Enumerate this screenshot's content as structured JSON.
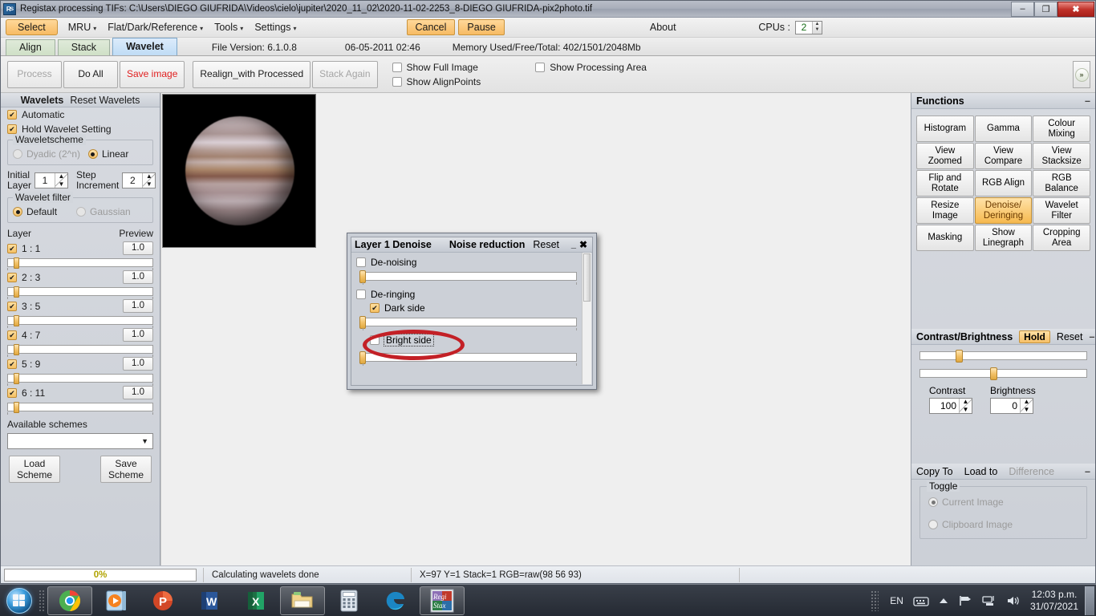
{
  "window": {
    "title": "Registax processing TIFs: C:\\Users\\DIEGO GIUFRIDA\\Videos\\cielo\\jupiter\\2020_11_02\\2020-11-02-2253_8-DIEGO GIUFRIDA-pix2photo.tif",
    "app_icon": "registax-icon",
    "minimize": "–",
    "maximize": "❐",
    "close": "✖"
  },
  "menubar": {
    "select": "Select",
    "items": [
      {
        "label": "MRU",
        "caret": "▾"
      },
      {
        "label": "Flat/Dark/Reference",
        "caret": "▾"
      },
      {
        "label": "Tools",
        "caret": "▾"
      },
      {
        "label": "Settings",
        "caret": "▾"
      }
    ],
    "cancel": "Cancel",
    "pause": "Pause",
    "about": "About",
    "cpus_label": "CPUs :",
    "cpus_value": "2"
  },
  "tabs": [
    {
      "label": "Align",
      "active": false
    },
    {
      "label": "Stack",
      "active": false
    },
    {
      "label": "Wavelet",
      "active": true
    }
  ],
  "tabbar_info": {
    "file_version": "File Version: 6.1.0.8",
    "date": "06-05-2011 02:46",
    "memory": "Memory Used/Free/Total: 402/1501/2048Mb"
  },
  "toolbar": {
    "process": "Process",
    "do_all": "Do All",
    "save_image": "Save image",
    "realign": "Realign_with Processed",
    "stack_again": "Stack Again",
    "show_full_image": "Show Full Image",
    "show_alignpoints": "Show AlignPoints",
    "show_processing_area": "Show Processing Area",
    "expand": "»"
  },
  "left_panel": {
    "header_title": "Wavelets",
    "header_link": "Reset Wavelets",
    "automatic": "Automatic",
    "hold_wavelet": "Hold Wavelet Setting",
    "waveletscheme_legend": "Waveletscheme",
    "dyadic": "Dyadic (2^n)",
    "linear": "Linear",
    "initial_layer_label": "Initial Layer",
    "initial_layer_value": "1",
    "step_increment_label": "Step Increment",
    "step_increment_value": "2",
    "wavelet_filter_legend": "Wavelet filter",
    "default": "Default",
    "gaussian": "Gaussian",
    "layer_col": "Layer",
    "preview_col": "Preview",
    "layers": [
      {
        "name": "1 : 1",
        "preview": "1.0",
        "checked": true,
        "slider": 8
      },
      {
        "name": "2 : 3",
        "preview": "1.0",
        "checked": true,
        "slider": 8
      },
      {
        "name": "3 : 5",
        "preview": "1.0",
        "checked": true,
        "slider": 8
      },
      {
        "name": "4 : 7",
        "preview": "1.0",
        "checked": true,
        "slider": 8
      },
      {
        "name": "5 : 9",
        "preview": "1.0",
        "checked": true,
        "slider": 8
      },
      {
        "name": "6 : 11",
        "preview": "1.0",
        "checked": true,
        "slider": 8
      }
    ],
    "available_schemes": "Available schemes",
    "scheme_value": "",
    "load_scheme": "Load Scheme",
    "save_scheme": "Save Scheme"
  },
  "right_panel": {
    "functions_title": "Functions",
    "minus": "–",
    "functions": [
      {
        "label": "Histogram",
        "selected": false
      },
      {
        "label": "Gamma",
        "selected": false
      },
      {
        "label": "Colour Mixing",
        "selected": false
      },
      {
        "label": "View Zoomed",
        "selected": false
      },
      {
        "label": "View Compare",
        "selected": false
      },
      {
        "label": "View Stacksize",
        "selected": false
      },
      {
        "label": "Flip and Rotate",
        "selected": false
      },
      {
        "label": "RGB Align",
        "selected": false
      },
      {
        "label": "RGB Balance",
        "selected": false
      },
      {
        "label": "Resize Image",
        "selected": false
      },
      {
        "label": "Denoise/ Deringing",
        "selected": true
      },
      {
        "label": "Wavelet Filter",
        "selected": false
      },
      {
        "label": "Masking",
        "selected": false
      },
      {
        "label": "Show Linegraph",
        "selected": false
      },
      {
        "label": "Cropping Area",
        "selected": false
      }
    ],
    "cb_title": "Contrast/Brightness",
    "cb_hold": "Hold",
    "cb_reset": "Reset",
    "contrast_label": "Contrast",
    "contrast_value": "100",
    "brightness_label": "Brightness",
    "brightness_value": "0",
    "copy_to": "Copy To",
    "load_to": "Load to",
    "difference": "Difference",
    "toggle_legend": "Toggle",
    "current_image": "Current Image",
    "clipboard_image": "Clipboard Image"
  },
  "dialog": {
    "title_left": "Layer 1 Denoise",
    "title_mid": "Noise reduction",
    "reset": "Reset",
    "minimize": "_",
    "close": "✖",
    "denoising": "De-noising",
    "deringing": "De-ringing",
    "dark_side": "Dark side",
    "bright_side": "Bright side"
  },
  "statusbar": {
    "progress_pct": "0%",
    "message": "Calculating wavelets done",
    "coords": "X=97 Y=1 Stack=1 RGB=raw(98 56 93)"
  },
  "taskbar": {
    "start": "start-orb-icon",
    "items": [
      {
        "name": "chrome-icon",
        "active": true
      },
      {
        "name": "media-player-icon",
        "active": false
      },
      {
        "name": "powerpoint-icon",
        "active": false
      },
      {
        "name": "word-icon",
        "active": false
      },
      {
        "name": "excel-icon",
        "active": false
      },
      {
        "name": "file-explorer-icon",
        "active": true
      },
      {
        "name": "calculator-icon",
        "active": false
      },
      {
        "name": "edge-icon",
        "active": false
      },
      {
        "name": "registax-icon",
        "active": true
      }
    ],
    "lang": "EN",
    "time": "12:03 p.m.",
    "date": "31/07/2021"
  }
}
